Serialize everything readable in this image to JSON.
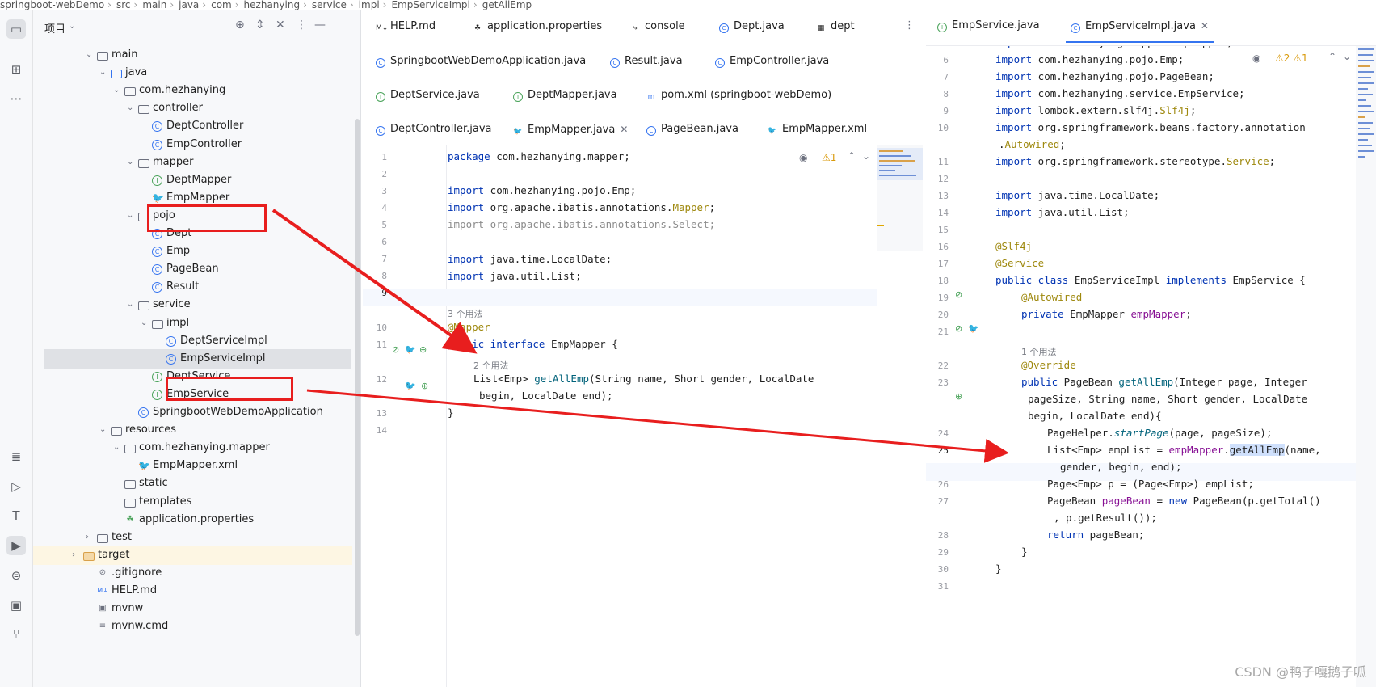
{
  "breadcrumb": [
    "springboot-webDemo",
    "src",
    "main",
    "java",
    "com",
    "hezhanying",
    "service",
    "impl",
    "EmpServiceImpl",
    "getAllEmp"
  ],
  "project": {
    "title": "项目",
    "tree": [
      {
        "label": "main",
        "indent": 1,
        "kind": "folder",
        "open": true
      },
      {
        "label": "java",
        "indent": 2,
        "kind": "folder-blue",
        "open": true
      },
      {
        "label": "com.hezhanying",
        "indent": 3,
        "kind": "pkg",
        "open": true
      },
      {
        "label": "controller",
        "indent": 4,
        "kind": "pkg",
        "open": true
      },
      {
        "label": "DeptController",
        "indent": 5,
        "kind": "class"
      },
      {
        "label": "EmpController",
        "indent": 5,
        "kind": "class"
      },
      {
        "label": "mapper",
        "indent": 4,
        "kind": "pkg",
        "open": true
      },
      {
        "label": "DeptMapper",
        "indent": 5,
        "kind": "interface"
      },
      {
        "label": "EmpMapper",
        "indent": 5,
        "kind": "mybatis"
      },
      {
        "label": "pojo",
        "indent": 4,
        "kind": "pkg",
        "open": true
      },
      {
        "label": "Dept",
        "indent": 5,
        "kind": "class"
      },
      {
        "label": "Emp",
        "indent": 5,
        "kind": "class"
      },
      {
        "label": "PageBean",
        "indent": 5,
        "kind": "class"
      },
      {
        "label": "Result",
        "indent": 5,
        "kind": "class"
      },
      {
        "label": "service",
        "indent": 4,
        "kind": "pkg",
        "open": true
      },
      {
        "label": "impl",
        "indent": 5,
        "kind": "pkg",
        "open": true
      },
      {
        "label": "DeptServiceImpl",
        "indent": 6,
        "kind": "class"
      },
      {
        "label": "EmpServiceImpl",
        "indent": 6,
        "kind": "class",
        "selected": true
      },
      {
        "label": "DeptService",
        "indent": 5,
        "kind": "interface"
      },
      {
        "label": "EmpService",
        "indent": 5,
        "kind": "interface"
      },
      {
        "label": "SpringbootWebDemoApplication",
        "indent": 4,
        "kind": "class"
      },
      {
        "label": "resources",
        "indent": 2,
        "kind": "folder",
        "open": true
      },
      {
        "label": "com.hezhanying.mapper",
        "indent": 3,
        "kind": "folder",
        "open": true
      },
      {
        "label": "EmpMapper.xml",
        "indent": 4,
        "kind": "mybatis"
      },
      {
        "label": "static",
        "indent": 3,
        "kind": "folder"
      },
      {
        "label": "templates",
        "indent": 3,
        "kind": "folder"
      },
      {
        "label": "application.properties",
        "indent": 3,
        "kind": "props"
      },
      {
        "label": "test",
        "indent": 1,
        "kind": "folder",
        "closed": true
      },
      {
        "label": "target",
        "indent": 0,
        "kind": "folder-orange",
        "closed": true,
        "highlight": true
      },
      {
        "label": ".gitignore",
        "indent": 1,
        "kind": "ignore"
      },
      {
        "label": "HELP.md",
        "indent": 1,
        "kind": "md"
      },
      {
        "label": "mvnw",
        "indent": 1,
        "kind": "term"
      },
      {
        "label": "mvnw.cmd",
        "indent": 1,
        "kind": "lines"
      }
    ]
  },
  "left_editor": {
    "tab_rows": [
      [
        {
          "label": "HELP.md",
          "icon": "M↓"
        },
        {
          "label": "application.properties",
          "icon": "☘"
        },
        {
          "label": "console",
          "icon": "⤷"
        },
        {
          "label": "Dept.java",
          "icon": "C"
        },
        {
          "label": "dept",
          "icon": "▦"
        }
      ],
      [
        {
          "label": "SpringbootWebDemoApplication.java",
          "icon": "C"
        },
        {
          "label": "Result.java",
          "icon": "C"
        },
        {
          "label": "EmpController.java",
          "icon": "C"
        }
      ],
      [
        {
          "label": "DeptService.java",
          "icon": "I"
        },
        {
          "label": "DeptMapper.java",
          "icon": "I"
        },
        {
          "label": "pom.xml (springboot-webDemo)",
          "icon": "m"
        }
      ],
      [
        {
          "label": "DeptController.java",
          "icon": "C"
        },
        {
          "label": "EmpMapper.java",
          "icon": "🐦",
          "active": true,
          "closable": true
        },
        {
          "label": "PageBean.java",
          "icon": "C"
        },
        {
          "label": "EmpMapper.xml",
          "icon": "🐦"
        }
      ]
    ],
    "warnings": "⚠1",
    "line_numbers": [
      "1",
      "2",
      "3",
      "4",
      "5",
      "6",
      "7",
      "8",
      "9",
      "10",
      "11",
      "12",
      "13",
      "14"
    ],
    "usage_hint_1": "3 个用法",
    "usage_hint_2": "2 个用法"
  },
  "right_editor": {
    "tabs": [
      {
        "label": "EmpService.java",
        "icon": "I"
      },
      {
        "label": "EmpServiceImpl.java",
        "icon": "C",
        "active": true,
        "closable": true
      }
    ],
    "warnings": "⚠2 ⚠1",
    "line_numbers": [
      "6",
      "7",
      "8",
      "9",
      "10",
      "11",
      "12",
      "13",
      "14",
      "15",
      "16",
      "17",
      "18",
      "19",
      "20",
      "21",
      "22",
      "23",
      "24",
      "25",
      "26",
      "27",
      "28",
      "29",
      "30",
      "31"
    ],
    "usage_hint": "1 个用法"
  },
  "watermark": "CSDN @鸭子嘎鹅子呱",
  "colors": {
    "annotation_red": "#e81e1e",
    "accent_blue": "#3574f0"
  }
}
